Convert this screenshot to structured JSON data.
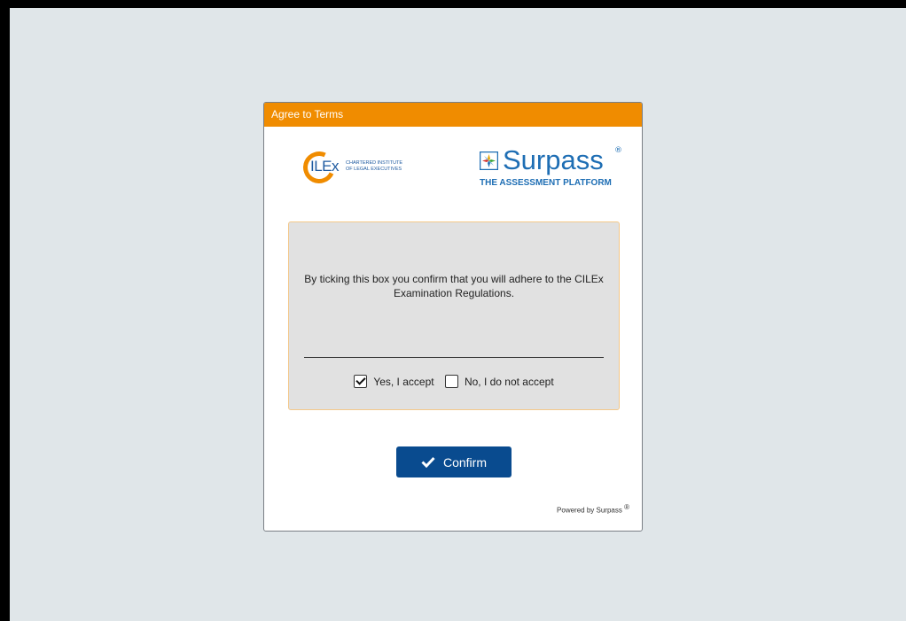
{
  "dialog": {
    "title": "Agree to Terms"
  },
  "logos": {
    "ilex_mark": "ILEx",
    "ilex_subtitle_line1": "CHARTERED INSTITUTE",
    "ilex_subtitle_line2": "OF LEGAL EXECUTIVES",
    "surpass_word": "Surpass",
    "surpass_registered": "®",
    "surpass_tagline": "THE ASSESSMENT PLATFORM"
  },
  "terms": {
    "text": "By ticking this box you confirm that you will adhere to the CILEx Examination Regulations.",
    "accept_label": "Yes, I accept",
    "accept_checked": true,
    "decline_label": "No, I do not accept",
    "decline_checked": false
  },
  "confirm": {
    "label": "Confirm"
  },
  "footer": {
    "powered_by": "Powered by Surpass",
    "registered": "®"
  },
  "colors": {
    "header": "#f08c00",
    "button": "#094b8f",
    "background": "#e0e6e9",
    "terms_box": "#e1e1e1"
  },
  "icons": [
    "checkmark-icon",
    "surpass-logo-icon"
  ]
}
